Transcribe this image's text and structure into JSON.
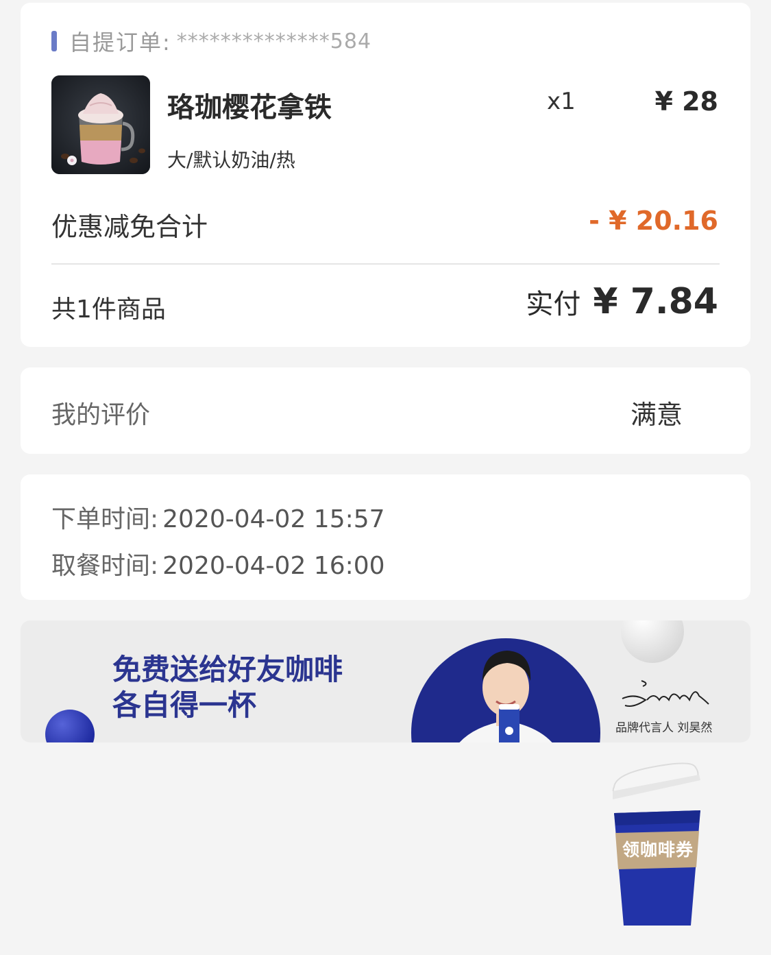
{
  "order": {
    "type_label": "自提订单:",
    "order_number": "**************584",
    "product": {
      "name": "珞珈樱花拿铁",
      "spec": "大/默认奶油/热",
      "qty": "x1",
      "price": "¥ 28"
    },
    "discount": {
      "label": "优惠减免合计",
      "value": "- ¥ 20.16"
    },
    "summary": {
      "count_label": "共1件商品",
      "paid_label": "实付",
      "paid_amount": "¥ 7.84"
    }
  },
  "review": {
    "label": "我的评价",
    "value": "满意"
  },
  "times": {
    "order_label": "下单时间:",
    "order_value": "2020-04-02 15:57",
    "pickup_label": "取餐时间:",
    "pickup_value": "2020-04-02 16:00"
  },
  "banner": {
    "line1": "免费送给好友咖啡",
    "line2": "各自得一杯",
    "caption": "品牌代言人 刘昊然"
  },
  "coupon": {
    "label": "领咖啡券"
  },
  "colors": {
    "accent_blue": "#1f2a8c",
    "discount_orange": "#e0692a",
    "order_bar": "#6a7bc7"
  },
  "icons": [
    "coffee-product-image",
    "coffee-cup-icon"
  ]
}
